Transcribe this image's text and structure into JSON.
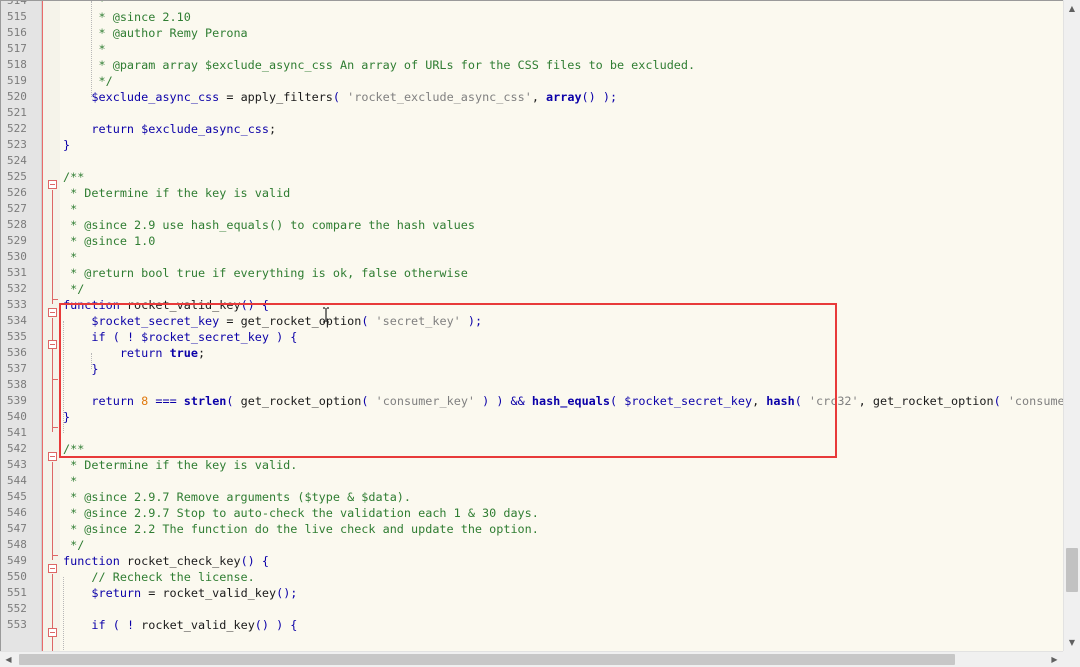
{
  "editor": {
    "lines": [
      {
        "num": "514",
        "tokens": [
          {
            "t": "     *",
            "c": "c"
          }
        ]
      },
      {
        "num": "515",
        "tokens": [
          {
            "t": "     * @since 2.10",
            "c": "c"
          }
        ]
      },
      {
        "num": "516",
        "tokens": [
          {
            "t": "     * @author Remy Perona",
            "c": "c"
          }
        ]
      },
      {
        "num": "517",
        "tokens": [
          {
            "t": "     *",
            "c": "c"
          }
        ]
      },
      {
        "num": "518",
        "tokens": [
          {
            "t": "     * @param array $exclude_async_css An array of URLs for the CSS files to be excluded.",
            "c": "c"
          }
        ]
      },
      {
        "num": "519",
        "tokens": [
          {
            "t": "     */",
            "c": "c"
          }
        ]
      },
      {
        "num": "520",
        "tokens": [
          {
            "t": "    ",
            "c": "p"
          },
          {
            "t": "$exclude_async_css",
            "c": "v"
          },
          {
            "t": " = ",
            "c": "p"
          },
          {
            "t": "apply_filters",
            "c": "f"
          },
          {
            "t": "( ",
            "c": "k"
          },
          {
            "t": "'rocket_exclude_async_css'",
            "c": "s"
          },
          {
            "t": ", ",
            "c": "p"
          },
          {
            "t": "array",
            "c": "kb"
          },
          {
            "t": "() );",
            "c": "k"
          }
        ]
      },
      {
        "num": "521",
        "tokens": []
      },
      {
        "num": "522",
        "tokens": [
          {
            "t": "    ",
            "c": "p"
          },
          {
            "t": "return",
            "c": "k"
          },
          {
            "t": " ",
            "c": "p"
          },
          {
            "t": "$exclude_async_css",
            "c": "v"
          },
          {
            "t": ";",
            "c": "p"
          }
        ]
      },
      {
        "num": "523",
        "tokens": [
          {
            "t": "}",
            "c": "k"
          }
        ]
      },
      {
        "num": "524",
        "tokens": []
      },
      {
        "num": "525",
        "tokens": [
          {
            "t": "/**",
            "c": "c"
          }
        ]
      },
      {
        "num": "526",
        "tokens": [
          {
            "t": " * Determine if the key is valid",
            "c": "c"
          }
        ]
      },
      {
        "num": "527",
        "tokens": [
          {
            "t": " *",
            "c": "c"
          }
        ]
      },
      {
        "num": "528",
        "tokens": [
          {
            "t": " * @since 2.9 use hash_equals() to compare the hash values",
            "c": "c"
          }
        ]
      },
      {
        "num": "529",
        "tokens": [
          {
            "t": " * @since 1.0",
            "c": "c"
          }
        ]
      },
      {
        "num": "530",
        "tokens": [
          {
            "t": " *",
            "c": "c"
          }
        ]
      },
      {
        "num": "531",
        "tokens": [
          {
            "t": " * @return bool true if everything is ok, false otherwise",
            "c": "c"
          }
        ]
      },
      {
        "num": "532",
        "tokens": [
          {
            "t": " */",
            "c": "c"
          }
        ]
      },
      {
        "num": "533",
        "tokens": [
          {
            "t": "function",
            "c": "k"
          },
          {
            "t": " rocket_valid_key",
            "c": "f"
          },
          {
            "t": "() {",
            "c": "k"
          }
        ]
      },
      {
        "num": "534",
        "tokens": [
          {
            "t": "    ",
            "c": "p"
          },
          {
            "t": "$rocket_secret_key",
            "c": "v"
          },
          {
            "t": " = ",
            "c": "p"
          },
          {
            "t": "get_rocket_option",
            "c": "f"
          },
          {
            "t": "( ",
            "c": "k"
          },
          {
            "t": "'secret_key'",
            "c": "s"
          },
          {
            "t": " );",
            "c": "k"
          }
        ]
      },
      {
        "num": "535",
        "tokens": [
          {
            "t": "    ",
            "c": "p"
          },
          {
            "t": "if",
            "c": "k"
          },
          {
            "t": " ( ! ",
            "c": "k"
          },
          {
            "t": "$rocket_secret_key",
            "c": "v"
          },
          {
            "t": " ) {",
            "c": "k"
          }
        ]
      },
      {
        "num": "536",
        "tokens": [
          {
            "t": "        ",
            "c": "p"
          },
          {
            "t": "return",
            "c": "k"
          },
          {
            "t": " ",
            "c": "p"
          },
          {
            "t": "true",
            "c": "kb"
          },
          {
            "t": ";",
            "c": "p"
          }
        ]
      },
      {
        "num": "537",
        "tokens": [
          {
            "t": "    }",
            "c": "k"
          }
        ]
      },
      {
        "num": "538",
        "tokens": []
      },
      {
        "num": "539",
        "tokens": [
          {
            "t": "    ",
            "c": "p"
          },
          {
            "t": "return",
            "c": "k"
          },
          {
            "t": " ",
            "c": "p"
          },
          {
            "t": "8",
            "c": "n"
          },
          {
            "t": " === ",
            "c": "k"
          },
          {
            "t": "strlen",
            "c": "fb"
          },
          {
            "t": "( ",
            "c": "k"
          },
          {
            "t": "get_rocket_option",
            "c": "f"
          },
          {
            "t": "( ",
            "c": "k"
          },
          {
            "t": "'consumer_key'",
            "c": "s"
          },
          {
            "t": " ) ) && ",
            "c": "k"
          },
          {
            "t": "hash_equals",
            "c": "fb"
          },
          {
            "t": "( ",
            "c": "k"
          },
          {
            "t": "$rocket_secret_key",
            "c": "v"
          },
          {
            "t": ", ",
            "c": "p"
          },
          {
            "t": "hash",
            "c": "fb"
          },
          {
            "t": "( ",
            "c": "k"
          },
          {
            "t": "'crc32'",
            "c": "s"
          },
          {
            "t": ", ",
            "c": "p"
          },
          {
            "t": "get_rocket_option",
            "c": "f"
          },
          {
            "t": "( ",
            "c": "k"
          },
          {
            "t": "'consumer_email'",
            "c": "s"
          },
          {
            "t": " ) ) );",
            "c": "k"
          }
        ]
      },
      {
        "num": "540",
        "tokens": [
          {
            "t": "}",
            "c": "k"
          }
        ]
      },
      {
        "num": "541",
        "tokens": []
      },
      {
        "num": "542",
        "tokens": [
          {
            "t": "/**",
            "c": "c"
          }
        ]
      },
      {
        "num": "543",
        "tokens": [
          {
            "t": " * Determine if the key is valid.",
            "c": "c"
          }
        ]
      },
      {
        "num": "544",
        "tokens": [
          {
            "t": " *",
            "c": "c"
          }
        ]
      },
      {
        "num": "545",
        "tokens": [
          {
            "t": " * @since 2.9.7 Remove arguments ($type & $data).",
            "c": "c"
          }
        ]
      },
      {
        "num": "546",
        "tokens": [
          {
            "t": " * @since 2.9.7 Stop to auto-check the validation each 1 & 30 days.",
            "c": "c"
          }
        ]
      },
      {
        "num": "547",
        "tokens": [
          {
            "t": " * @since 2.2 The function do the live check and update the option.",
            "c": "c"
          }
        ]
      },
      {
        "num": "548",
        "tokens": [
          {
            "t": " */",
            "c": "c"
          }
        ]
      },
      {
        "num": "549",
        "tokens": [
          {
            "t": "function",
            "c": "k"
          },
          {
            "t": " rocket_check_key",
            "c": "f"
          },
          {
            "t": "() {",
            "c": "k"
          }
        ]
      },
      {
        "num": "550",
        "tokens": [
          {
            "t": "    // Recheck the license.",
            "c": "c"
          }
        ]
      },
      {
        "num": "551",
        "tokens": [
          {
            "t": "    ",
            "c": "p"
          },
          {
            "t": "$return",
            "c": "v"
          },
          {
            "t": " = ",
            "c": "p"
          },
          {
            "t": "rocket_valid_key",
            "c": "f"
          },
          {
            "t": "();",
            "c": "k"
          }
        ]
      },
      {
        "num": "552",
        "tokens": []
      },
      {
        "num": "553",
        "tokens": [
          {
            "t": "    ",
            "c": "p"
          },
          {
            "t": "if",
            "c": "k"
          },
          {
            "t": " ( ! ",
            "c": "k"
          },
          {
            "t": "rocket_valid_key",
            "c": "f"
          },
          {
            "t": "() ) {",
            "c": "k"
          }
        ]
      }
    ]
  },
  "icons": {
    "fold_marker": "fold-minus-icon",
    "text_cursor": "ibeam-cursor-icon",
    "scroll_up": "arrow-up-icon",
    "scroll_down": "arrow-down-icon",
    "scroll_left": "arrow-left-icon",
    "scroll_right": "arrow-right-icon"
  },
  "colors": {
    "highlight_box": "#e83a3a",
    "comment": "#2f7d32",
    "keyword": "#0b00a8",
    "string": "#808080",
    "number": "#e07a10",
    "editor_background": "#fbf9ef"
  }
}
